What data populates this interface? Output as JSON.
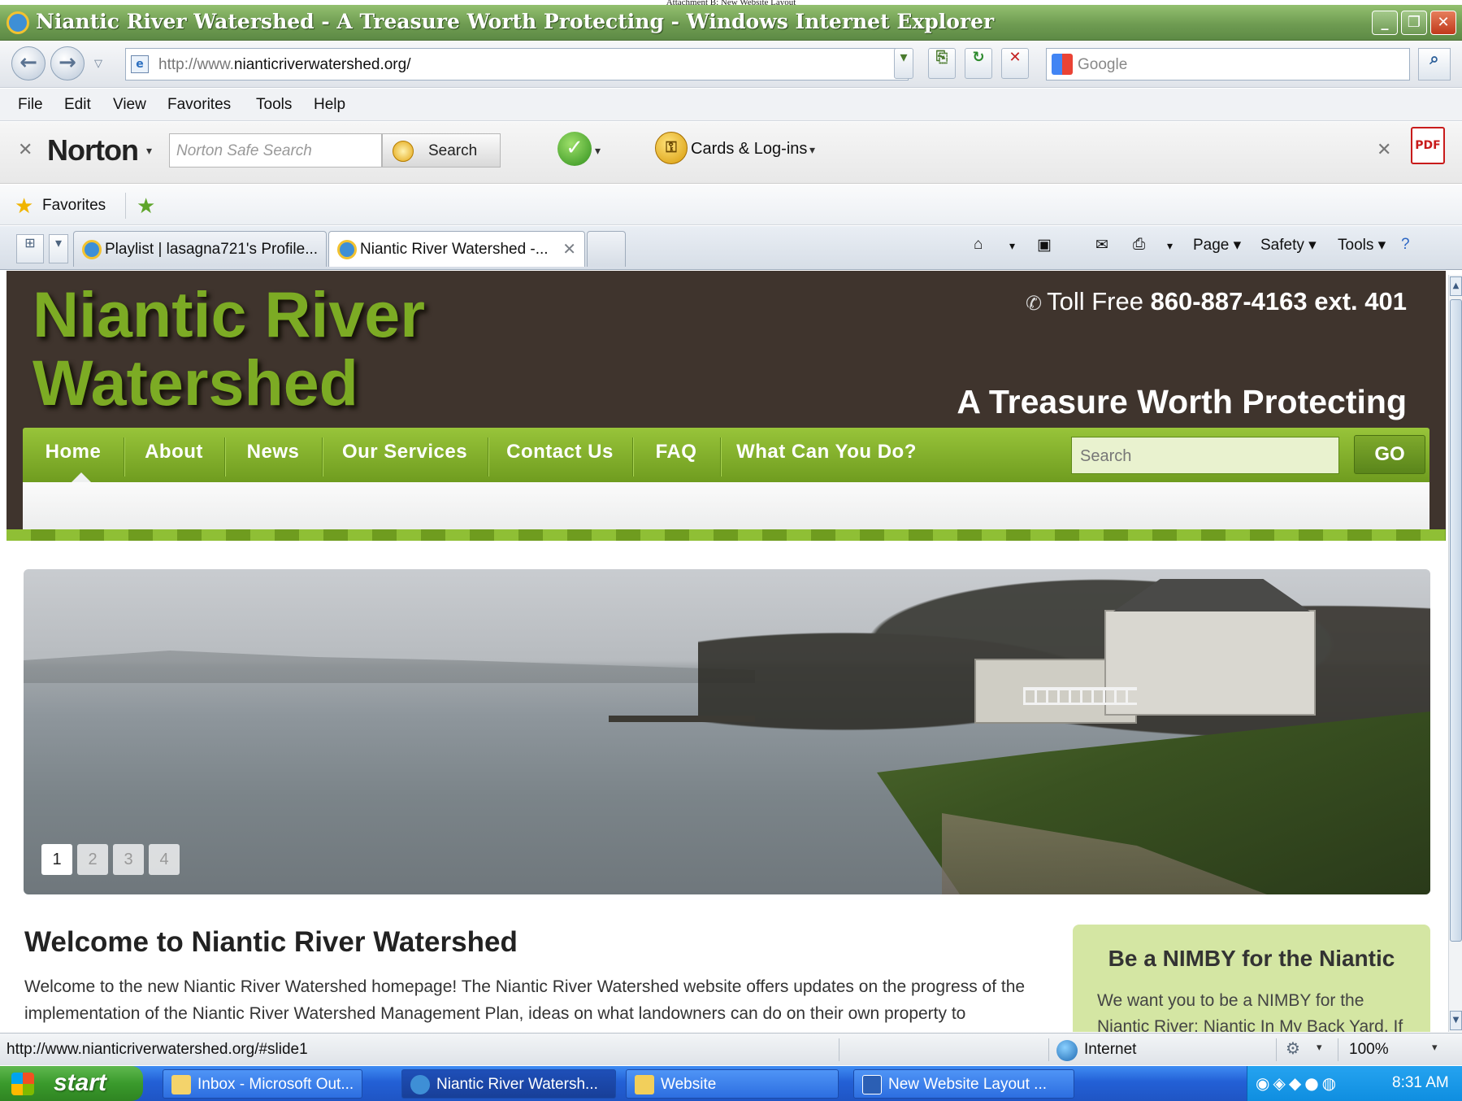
{
  "doc_caption": "Attachment B: New Website Layout",
  "window": {
    "title": "Niantic River Watershed - A Treasure Worth Protecting - Windows Internet Explorer",
    "min_label": "_",
    "restore_label": "❐",
    "close_label": "✕"
  },
  "address_bar": {
    "back_icon": "back-arrow-icon",
    "forward_icon": "forward-arrow-icon",
    "url_prefix": "http://www.",
    "url_domain": "nianticriverwatershed.org/",
    "search_placeholder": "Google"
  },
  "menu": {
    "items": [
      "File",
      "Edit",
      "View",
      "Favorites",
      "Tools",
      "Help"
    ]
  },
  "norton_toolbar": {
    "brand": "Norton",
    "search_placeholder": "Norton Safe Search",
    "search_button": "Search",
    "cards_label": "Cards & Log-ins"
  },
  "favorites_bar": {
    "label": "Favorites"
  },
  "tabs": [
    {
      "label": "Playlist | lasagna721's Profile...",
      "active": false
    },
    {
      "label": "Niantic River Watershed -...",
      "active": true
    }
  ],
  "command_bar": {
    "page": "Page ▾",
    "safety": "Safety ▾",
    "tools": "Tools ▾"
  },
  "site": {
    "logo_line1": "Niantic River",
    "logo_line2": "Watershed",
    "toll_label": "Toll Free",
    "toll_number": "860-887-4163 ext. 401",
    "tagline": "A Treasure Worth Protecting",
    "nav": [
      "Home",
      "About",
      "News",
      "Our Services",
      "Contact Us",
      "FAQ",
      "What Can You Do?"
    ],
    "search_placeholder": "Search",
    "search_button": "GO",
    "slider_pages": [
      "1",
      "2",
      "3",
      "4"
    ],
    "slider_active_page": 1,
    "welcome_title": "Welcome to Niantic River Watershed",
    "welcome_text": "Welcome to the new Niantic River Watershed homepage! The Niantic River Watershed website offers updates on the progress of the implementation of the Niantic River Watershed Management Plan, ideas on what landowners can do on their own property to",
    "sidebar_title": "Be a NIMBY for the Niantic",
    "sidebar_text": "We want you to be a NIMBY for the Niantic River: Niantic In My Back Yard. If"
  },
  "status_bar": {
    "url": "http://www.nianticriverwatershed.org/#slide1",
    "zone": "Internet",
    "zoom": "100%"
  },
  "taskbar": {
    "start": "start",
    "tasks": [
      {
        "label": "Inbox - Microsoft Out...",
        "active": false
      },
      {
        "label": "Niantic River Watersh...",
        "active": true
      },
      {
        "label": "Website",
        "active": false
      },
      {
        "label": "New Website Layout ...",
        "active": false
      }
    ],
    "clock": "8:31 AM"
  },
  "colors": {
    "header_bg": "#3f342d",
    "logo_green": "#7cab24",
    "nav_green": "#8cbb30",
    "sidebar_bg": "#d4e6a3"
  }
}
